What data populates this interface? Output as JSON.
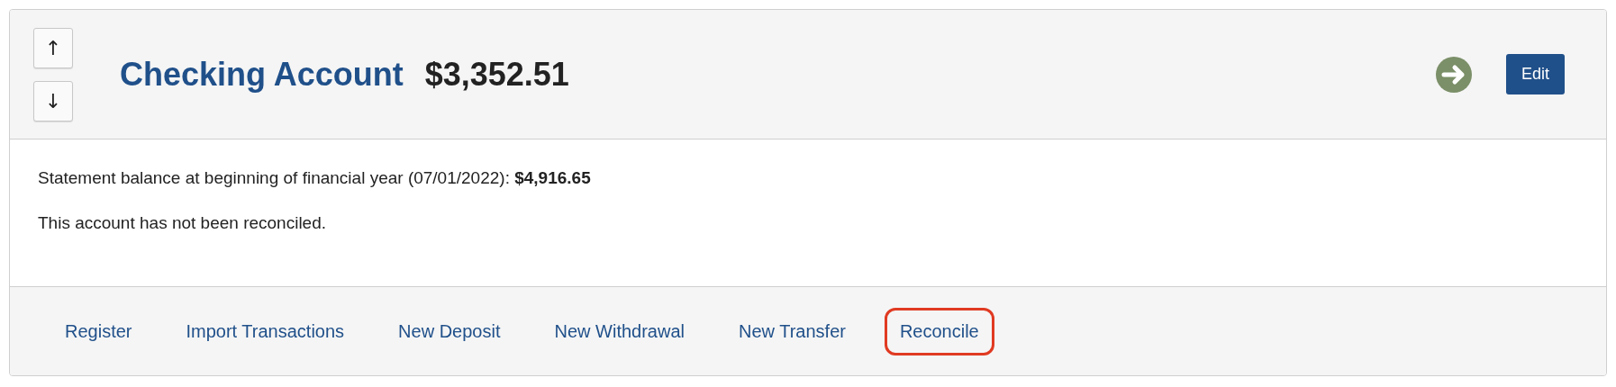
{
  "account": {
    "name": "Checking Account",
    "balance": "$3,352.51",
    "move_up": "↑",
    "move_down": "↓",
    "edit_label": "Edit"
  },
  "details": [
    {
      "text": "Statement balance at beginning of financial year (07/01/2022): **$4,916.65**"
    },
    {
      "text": "This account has not been reconciled."
    }
  ],
  "actions": [
    {
      "label": "Register",
      "highlighted": false
    },
    {
      "label": "Import Transactions",
      "highlighted": false
    },
    {
      "label": "New Deposit",
      "highlighted": false
    },
    {
      "label": "New Withdrawal",
      "highlighted": false
    },
    {
      "label": "New Transfer",
      "highlighted": false
    },
    {
      "label": "Reconcile",
      "highlighted": true
    }
  ]
}
